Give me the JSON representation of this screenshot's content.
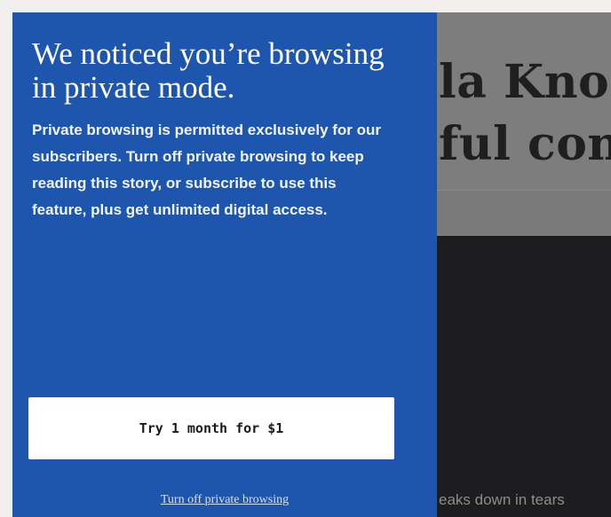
{
  "article": {
    "headline_line1": "la Kno",
    "headline_line2": "ful con",
    "video_caption": "eaks down in tears"
  },
  "modal": {
    "title": "We noticed you’re browsing in private mode.",
    "body": "Private browsing is permitted exclusively for our subscribers. Turn off private browsing to keep reading this story, or subscribe to use this feature, plus get unlimited digital access.",
    "cta_label": "Try 1 month for $1",
    "secondary_link_label": "Turn off private browsing"
  },
  "colors": {
    "modal_background": "#1e56ad",
    "button_background": "#ffffff",
    "page_background": "#f1f0ee",
    "video_background": "#1d1c1e"
  }
}
